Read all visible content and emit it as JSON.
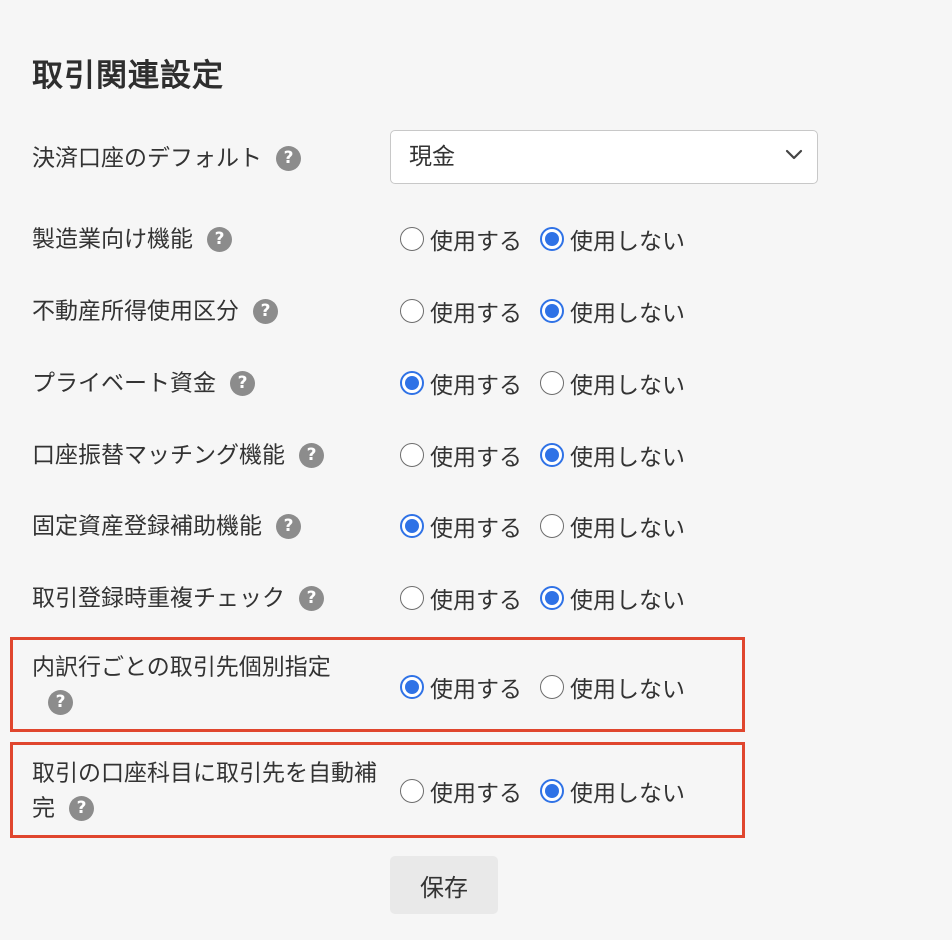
{
  "page": {
    "title": "取引関連設定"
  },
  "colors": {
    "accent": "#2f72e6",
    "highlight": "#e0462e",
    "help_icon": "#8c8c8c"
  },
  "default_account": {
    "label": "決済口座のデフォルト",
    "help_icon": "?",
    "selected_value": "現金"
  },
  "option_labels": {
    "use": "使用する",
    "not_use": "使用しない"
  },
  "settings": [
    {
      "label": "製造業向け機能",
      "help_icon": "?",
      "selected": "not_use"
    },
    {
      "label": "不動産所得使用区分",
      "help_icon": "?",
      "selected": "not_use"
    },
    {
      "label": "プライベート資金",
      "help_icon": "?",
      "selected": "use"
    },
    {
      "label": "口座振替マッチング機能",
      "help_icon": "?",
      "selected": "not_use"
    },
    {
      "label": "固定資産登録補助機能",
      "help_icon": "?",
      "selected": "use"
    },
    {
      "label": "取引登録時重複チェック",
      "help_icon": "?",
      "selected": "not_use"
    },
    {
      "label": "内訳行ごとの取引先個別指定",
      "help_icon": "?",
      "selected": "use",
      "highlighted": true
    },
    {
      "label": "取引の口座科目に取引先を自動補完",
      "help_icon": "?",
      "selected": "not_use",
      "highlighted": true
    }
  ],
  "actions": {
    "save_label": "保存"
  }
}
